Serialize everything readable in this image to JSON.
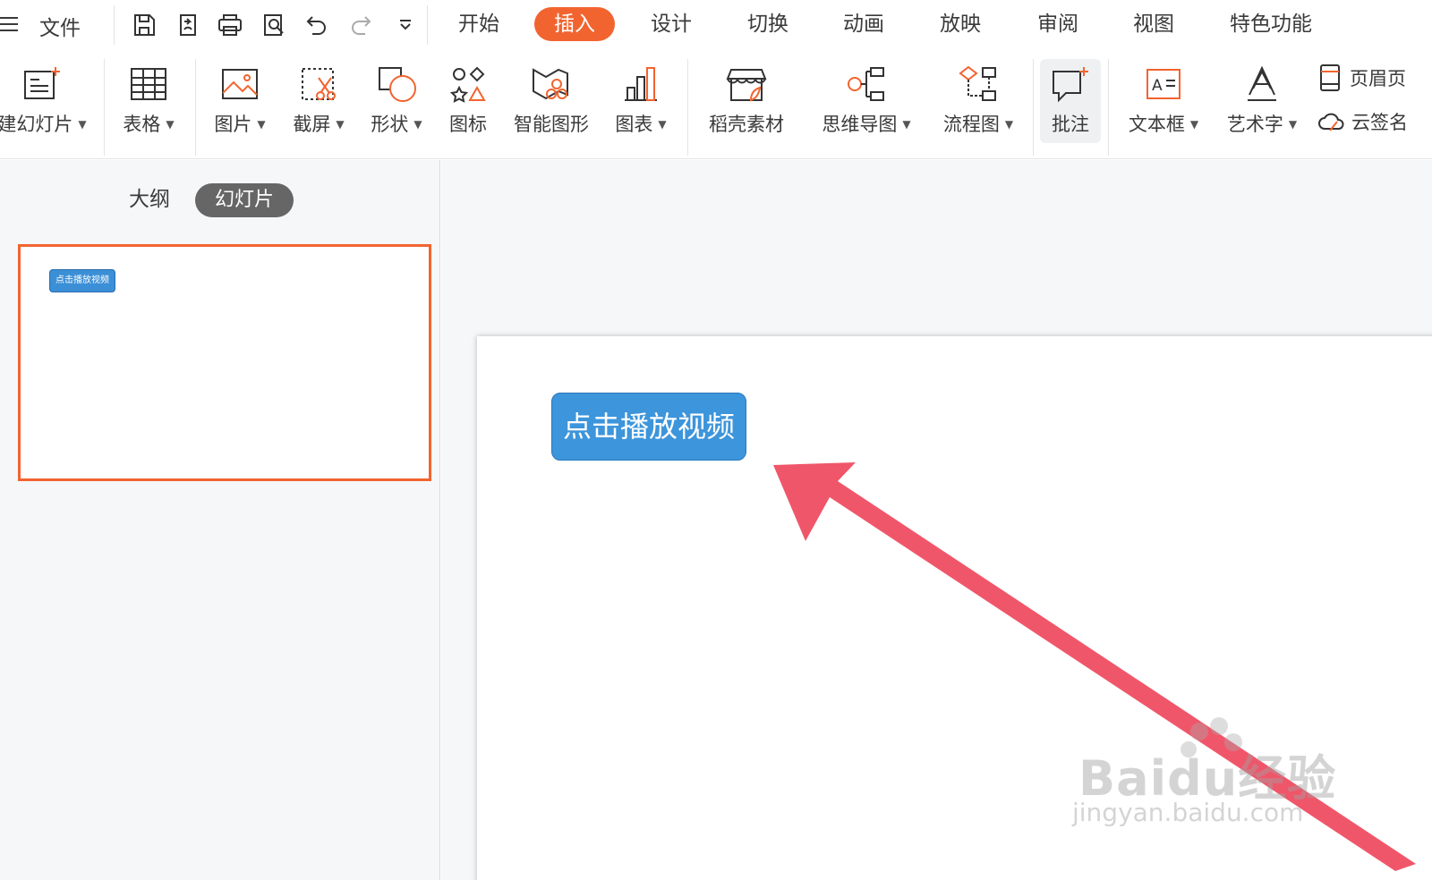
{
  "menu": {
    "file": "文件",
    "tabs": [
      "开始",
      "插入",
      "设计",
      "切换",
      "动画",
      "放映",
      "审阅",
      "视图",
      "特色功能"
    ],
    "active_tab": "插入"
  },
  "quick_access": [
    "save-icon",
    "export-icon",
    "print-icon",
    "print-preview-icon",
    "undo-icon",
    "redo-icon",
    "more-dropdown-icon"
  ],
  "ribbon": {
    "new_slide": "建幻灯片",
    "table": "表格",
    "picture": "图片",
    "screenshot": "截屏",
    "shape": "形状",
    "icon": "图标",
    "smartart": "智能图形",
    "chart": "图表",
    "material": "稻壳素材",
    "mindmap": "思维导图",
    "flowchart": "流程图",
    "comment": "批注",
    "textbox": "文本框",
    "wordart": "艺术字",
    "header_footer": "页眉页",
    "cloud_sign": "云签名"
  },
  "left_panel": {
    "outline_tab": "大纲",
    "slides_tab": "幻灯片",
    "thumb_button_text": "点击播放视频"
  },
  "slide": {
    "button_text": "点击播放视频"
  },
  "watermark": {
    "brand": "Baidu经验",
    "url": "jingyan.baidu.com"
  },
  "colors": {
    "accent": "#f2642f",
    "button_blue": "#3d95db",
    "arrow": "#f0566a"
  }
}
